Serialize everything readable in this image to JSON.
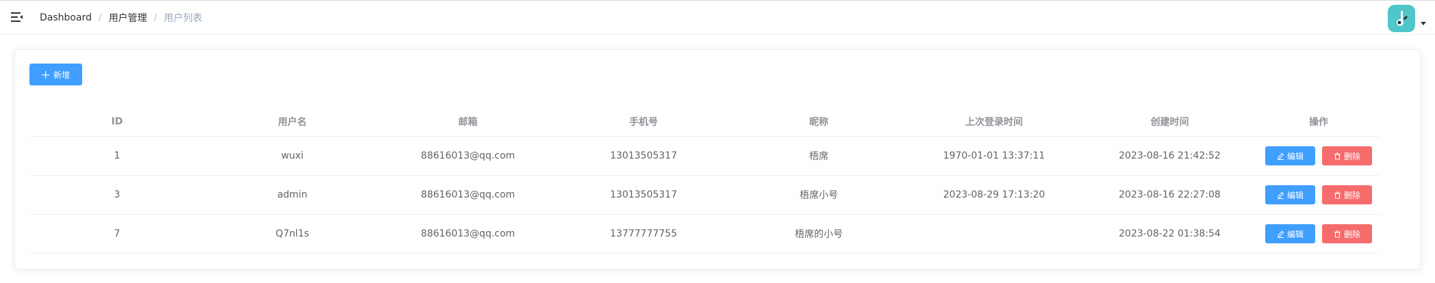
{
  "breadcrumb": {
    "items": [
      "Dashboard",
      "用户管理",
      "用户列表"
    ],
    "separator": "/"
  },
  "toolbar": {
    "add_label": "新增"
  },
  "table": {
    "headers": [
      "ID",
      "用户名",
      "邮箱",
      "手机号",
      "昵称",
      "上次登录时间",
      "创建时间",
      "操作"
    ],
    "rows": [
      {
        "id": "1",
        "username": "wuxi",
        "email": "88616013@qq.com",
        "phone": "13013505317",
        "nickname": "梧席",
        "last_login": "1970-01-01 13:37:11",
        "created": "2023-08-16 21:42:52"
      },
      {
        "id": "3",
        "username": "admin",
        "email": "88616013@qq.com",
        "phone": "13013505317",
        "nickname": "梧席小号",
        "last_login": "2023-08-29 17:13:20",
        "created": "2023-08-16 22:27:08"
      },
      {
        "id": "7",
        "username": "Q7nl1s",
        "email": "88616013@qq.com",
        "phone": "13777777755",
        "nickname": "梧席的小号",
        "last_login": "",
        "created": "2023-08-22 01:38:54"
      }
    ],
    "edit_label": "编辑",
    "delete_label": "删除"
  },
  "colors": {
    "primary": "#409eff",
    "danger": "#f56c6c",
    "avatar_bg": "#4fc6c8"
  },
  "icons": [
    "hamburger-icon",
    "plus-icon",
    "edit-icon",
    "delete-icon",
    "avatar-icon",
    "caret-down-icon"
  ]
}
